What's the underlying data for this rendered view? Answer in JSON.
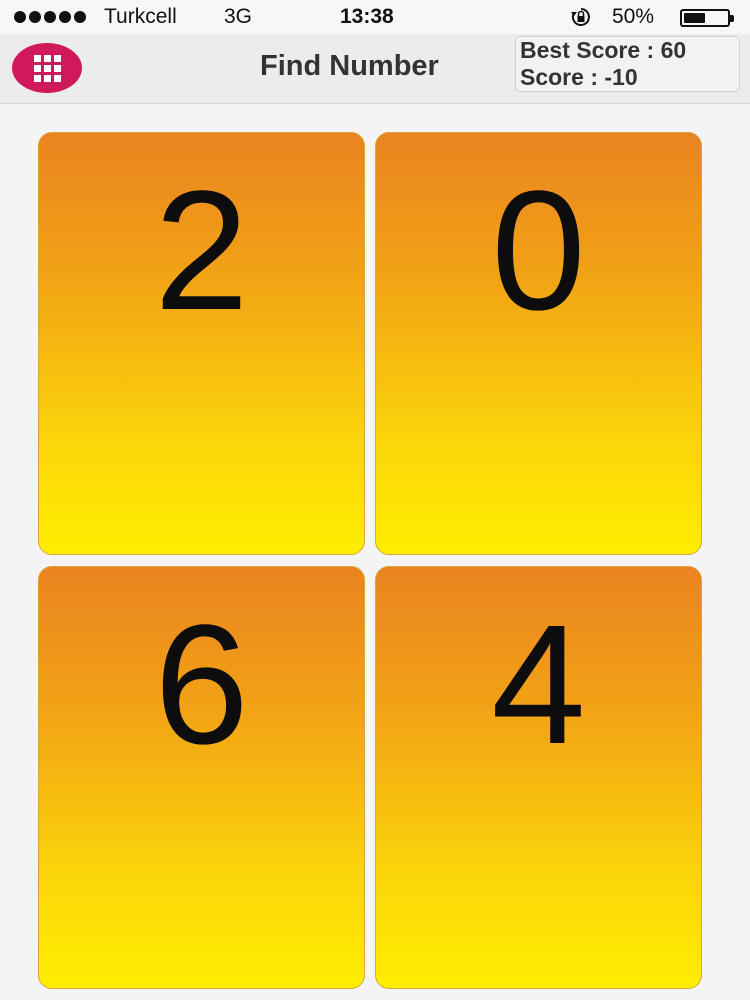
{
  "status_bar": {
    "carrier": "Turkcell",
    "network": "3G",
    "time": "13:38",
    "battery": "50%",
    "battery_level": 0.5
  },
  "nav": {
    "title": "Find Number",
    "menu_icon": "grid-icon",
    "menu_color": "#d0195a"
  },
  "score": {
    "best": "Best Score : 60",
    "current": "Score : -10"
  },
  "cards": [
    {
      "number": "2"
    },
    {
      "number": "0"
    },
    {
      "number": "6"
    },
    {
      "number": "4"
    }
  ],
  "colors": {
    "card_top": "#ea8320",
    "card_bottom": "#ffee00"
  }
}
